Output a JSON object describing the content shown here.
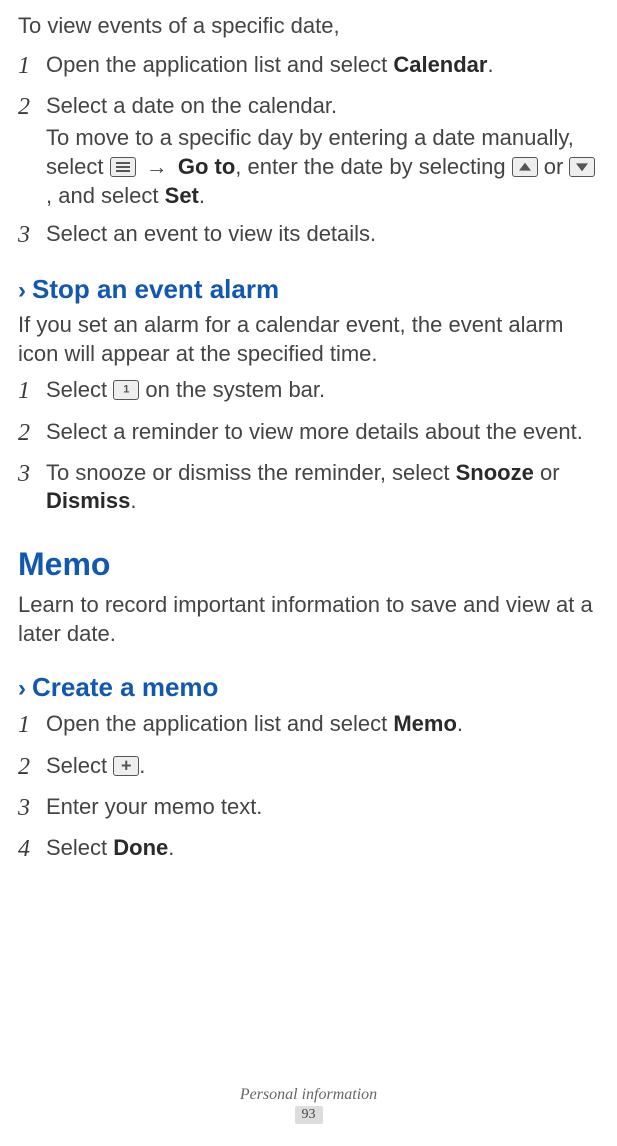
{
  "introA": "To view events of a specific date,",
  "stepsA": [
    {
      "num": "1",
      "parts": [
        "Open the application list and select ",
        {
          "b": "Calendar"
        },
        "."
      ]
    },
    {
      "num": "2",
      "parts": [
        "Select a date on the calendar."
      ],
      "sub": [
        "To move to a specific day by entering a date manually, select ",
        {
          "icon": "lines"
        },
        " ",
        {
          "arrow": "→"
        },
        " ",
        {
          "b": "Go to"
        },
        ", enter the date by selecting ",
        {
          "icon": "up"
        },
        " or ",
        {
          "icon": "down"
        },
        ", and select ",
        {
          "b": "Set"
        },
        "."
      ]
    },
    {
      "num": "3",
      "parts": [
        "Select an event to view its details."
      ]
    }
  ],
  "h2a": "Stop an event alarm",
  "descA": "If you set an alarm for a calendar event, the event alarm icon will appear at the specified time.",
  "stepsB": [
    {
      "num": "1",
      "parts": [
        "Select ",
        {
          "icon": "notif"
        },
        " on the system bar."
      ]
    },
    {
      "num": "2",
      "parts": [
        "Select a reminder to view more details about the event."
      ]
    },
    {
      "num": "3",
      "parts": [
        "To snooze or dismiss the reminder, select ",
        {
          "b": "Snooze"
        },
        " or ",
        {
          "b": "Dismiss"
        },
        "."
      ]
    }
  ],
  "h1": "Memo",
  "descB": "Learn to record important information to save and view at a later date.",
  "h2b": "Create a memo",
  "stepsC": [
    {
      "num": "1",
      "parts": [
        "Open the application list and select ",
        {
          "b": "Memo"
        },
        "."
      ]
    },
    {
      "num": "2",
      "parts": [
        "Select ",
        {
          "icon": "plus"
        },
        "."
      ]
    },
    {
      "num": "3",
      "parts": [
        "Enter your memo text."
      ]
    },
    {
      "num": "4",
      "parts": [
        "Select ",
        {
          "b": "Done"
        },
        "."
      ]
    }
  ],
  "footer": {
    "section": "Personal information",
    "page": "93"
  }
}
